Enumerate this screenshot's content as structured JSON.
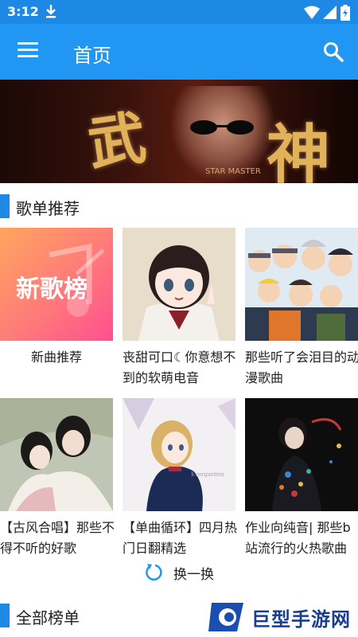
{
  "status_bar": {
    "time": "3:12"
  },
  "header": {
    "title": "首页"
  },
  "banner": {
    "char1": "武",
    "char2": "神",
    "subtitle": "STAR MASTER"
  },
  "recommend_section": {
    "title": "歌单推荐"
  },
  "playlists": [
    {
      "title": "新曲推荐",
      "cover_text": "新歌榜",
      "colors": [
        "#ff9a5a",
        "#ff5c8a"
      ]
    },
    {
      "title": "丧甜可口☾你意想不到的软萌电音"
    },
    {
      "title": "那些听了会泪目的动漫歌曲"
    },
    {
      "title": "【古风合唱】那些不得不听的好歌"
    },
    {
      "title": "【单曲循环】四月热门日翻精选"
    },
    {
      "title": "作业向纯音| 那些b站流行的火热歌曲"
    }
  ],
  "refresh": {
    "label": "换一换"
  },
  "all_charts_section": {
    "title": "全部榜单"
  },
  "watermark": {
    "text": "巨型手游网"
  },
  "colors": {
    "accent": "#2196f3",
    "status": "#1e88e5"
  }
}
